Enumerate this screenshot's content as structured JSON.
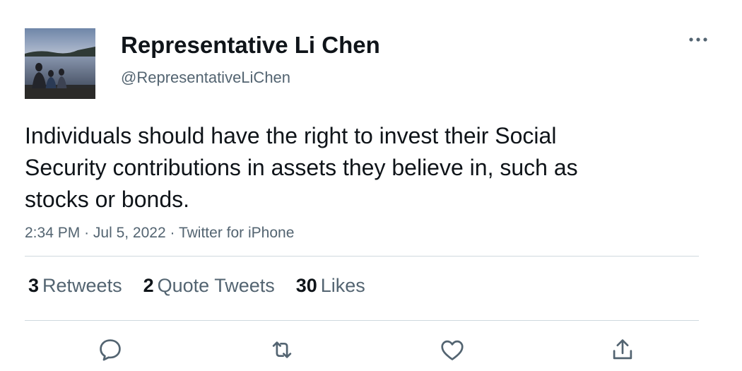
{
  "author": {
    "display_name": "Representative Li Chen",
    "handle": "@RepresentativeLiChen",
    "avatar_icon": "lakeside-photo-avatar"
  },
  "tweet": {
    "text": "Individuals should have the right to invest their Social Security contributions in assets they believe in, such as stocks or bonds.",
    "time": "2:34 PM",
    "separator": "·",
    "date": "Jul 5, 2022",
    "source": "Twitter for iPhone"
  },
  "stats": {
    "retweets": {
      "count": "3",
      "label": "Retweets"
    },
    "quote_tweets": {
      "count": "2",
      "label": "Quote Tweets"
    },
    "likes": {
      "count": "30",
      "label": "Likes"
    }
  },
  "actions": [
    "reply-icon",
    "retweet-icon",
    "like-icon",
    "share-icon"
  ],
  "colors": {
    "text_primary": "#0f1419",
    "text_secondary": "#536471",
    "divider": "#cfd9de"
  }
}
